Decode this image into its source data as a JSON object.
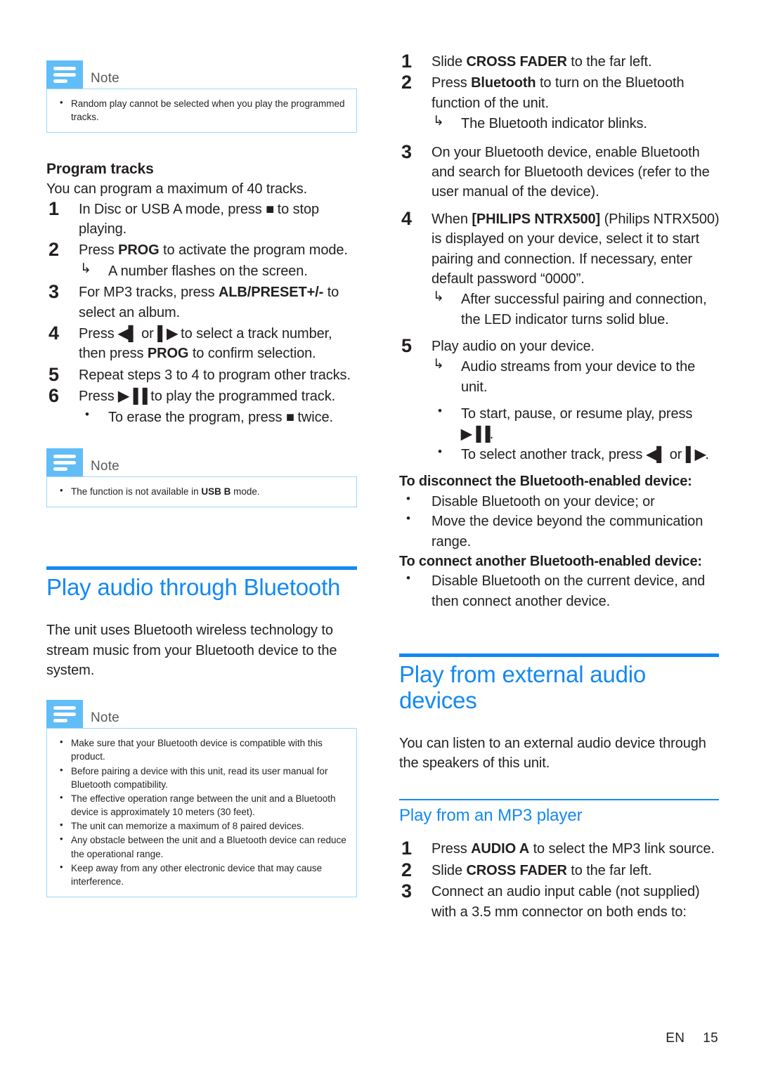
{
  "page": {
    "language_code": "EN",
    "page_number": "15"
  },
  "colors": {
    "heading_blue": "#1389f2",
    "note_icon_blue": "#61bdf7",
    "note_border_blue": "#9fd8f5",
    "body_text": "#231f20",
    "note_title_gray": "#58595b"
  },
  "icons": {
    "note_icon": "note-lines-icon",
    "stop": "■",
    "prev_track": "◀▌",
    "next_track": "▌▶",
    "play_pause": "▶▐▐",
    "result_arrow": "↳",
    "bullet": "•"
  },
  "left_column": {
    "note_1": {
      "title": "Note",
      "bullets": [
        "Random play cannot be selected when you play the programmed tracks."
      ]
    },
    "program_tracks": {
      "heading": "Program tracks",
      "intro": "You can program a maximum of 40 tracks.",
      "steps": [
        {
          "text_before": "In Disc or USB A mode, press ",
          "glyph": "stop",
          "text_after": " to stop playing."
        },
        {
          "text_before": "Press ",
          "bold": "PROG",
          "text_after": " to activate the program mode.",
          "result": "A number flashes on the screen."
        },
        {
          "text_before": "For MP3 tracks, press ",
          "bold": "ALB/PRESET+/-",
          "text_after": " to select an album."
        },
        {
          "text_before": "Press ",
          "glyph": "prev_track",
          "text_mid": " or ",
          "glyph2": "next_track",
          "text_after": " to select a track number, then press ",
          "bold": "PROG",
          "text_end": " to confirm selection."
        },
        {
          "text_before": "Repeat steps 3 to 4 to program other tracks."
        },
        {
          "text_before": "Press ",
          "glyph": "play_pause",
          "text_after": " to play the programmed track.",
          "sub_bullet_before": "To erase the program, press ",
          "sub_bullet_glyph": "stop",
          "sub_bullet_after": " twice."
        }
      ]
    },
    "note_2": {
      "title": "Note",
      "bullet_before": "The function is not available in ",
      "bullet_bold": "USB B",
      "bullet_after": " mode."
    },
    "bluetooth_section": {
      "heading": "Play audio through Bluetooth",
      "intro": "The unit uses Bluetooth wireless technology to stream music from your Bluetooth device to the system."
    },
    "note_3": {
      "title": "Note",
      "bullets": [
        "Make sure that your Bluetooth device is compatible with this product.",
        "Before pairing a device with this unit, read its user manual for Bluetooth compatibility.",
        "The effective operation range between the unit and a Bluetooth device is approximately 10 meters (30 feet).",
        "The unit can memorize a maximum of 8 paired devices.",
        "Any obstacle between the unit and a Bluetooth device can reduce the operational range.",
        "Keep away from any other electronic device that may cause interference."
      ]
    }
  },
  "right_column": {
    "bluetooth_steps": [
      {
        "text_before": "Slide ",
        "bold": "CROSS FADER",
        "text_after": " to the far left."
      },
      {
        "text_before": "Press ",
        "bold": "Bluetooth",
        "text_after": " to turn on the Bluetooth function of the unit.",
        "result": "The Bluetooth indicator blinks."
      },
      {
        "text_before": "On your Bluetooth device, enable Bluetooth and search for Bluetooth devices (refer to the user manual of the device)."
      },
      {
        "text_before": "When ",
        "bold": "[PHILIPS NTRX500]",
        "text_after": " (Philips NTRX500) is displayed on your device, select it to start pairing and connection. If necessary, enter default password “0000”.",
        "result": "After successful pairing and connection, the LED indicator turns solid blue."
      },
      {
        "text_before": "Play audio on your device.",
        "result": "Audio streams from your device to the unit.",
        "sub_bullet_1_before": "To start, pause, or resume play, press ",
        "sub_bullet_1_glyph": "play_pause",
        "sub_bullet_1_after": ".",
        "sub_bullet_2_before": "To select another track, press ",
        "sub_bullet_2_glyph": "prev_track",
        "sub_bullet_2_mid": " or ",
        "sub_bullet_2_glyph2": "next_track",
        "sub_bullet_2_after": "."
      }
    ],
    "disconnect": {
      "heading": "To disconnect the Bluetooth-enabled device:",
      "bullets": [
        "Disable Bluetooth on your device; or",
        "Move the device beyond the communication range."
      ]
    },
    "connect_another": {
      "heading": "To connect another Bluetooth-enabled device:",
      "bullets": [
        "Disable Bluetooth on the current device, and then connect another device."
      ]
    },
    "external_audio": {
      "heading": "Play from external audio devices",
      "intro": "You can listen to an external audio device through the speakers of this unit."
    },
    "mp3_player": {
      "heading": "Play from an MP3 player",
      "steps": [
        {
          "text_before": "Press ",
          "bold": "AUDIO A",
          "text_after": " to select the MP3 link source."
        },
        {
          "text_before": "Slide ",
          "bold": "CROSS FADER",
          "text_after": " to the far left."
        },
        {
          "text_before": "Connect an audio input cable (not supplied) with a 3.5 mm connector on both ends to:"
        }
      ]
    }
  }
}
